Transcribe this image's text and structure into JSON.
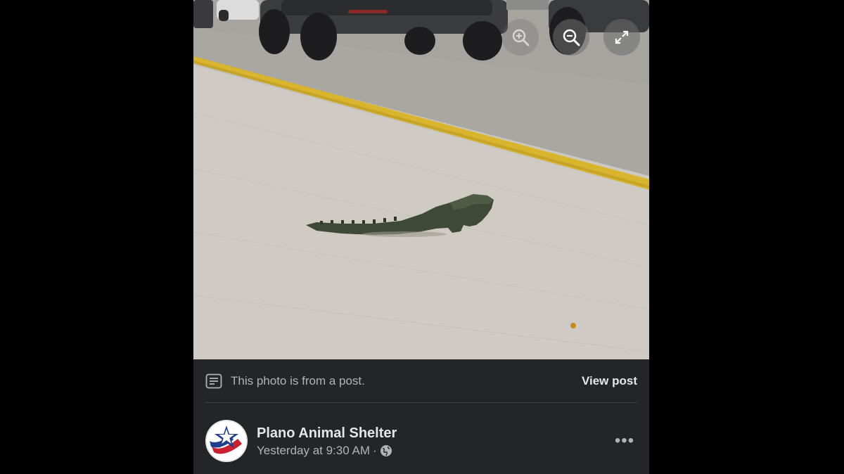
{
  "viewer": {
    "photo_alt": "",
    "controls": [
      {
        "name": "zoom-in-icon",
        "label": "Zoom in"
      },
      {
        "name": "zoom-out-icon",
        "label": "Zoom out"
      },
      {
        "name": "fullscreen-icon",
        "label": "Enter fullscreen"
      }
    ]
  },
  "footer": {
    "notice": "This photo is from a post.",
    "notice_icon": "post-document-icon",
    "view_post": "View post"
  },
  "post": {
    "author": "Plano Animal Shelter",
    "timestamp": "Yesterday at 9:30 AM",
    "separator": "·",
    "privacy_icon": "globe-icon",
    "more": "•••"
  },
  "colors": {
    "background": "#000000",
    "panel": "#242526",
    "primary_text": "#e4e6eb",
    "secondary_text": "#b0b3b8",
    "divider": "#3e4042",
    "road_line": "#e0b830"
  }
}
